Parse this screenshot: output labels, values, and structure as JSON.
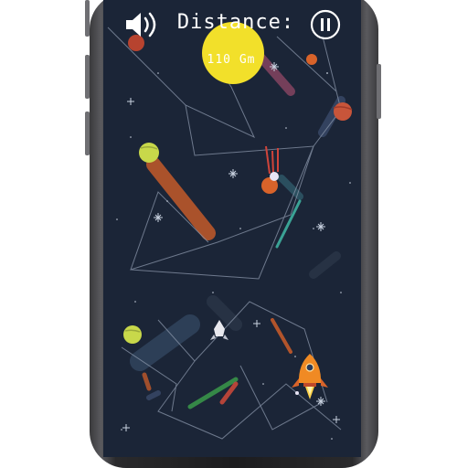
{
  "hud": {
    "distance_label": "Distance:",
    "distance_value": "110 Gm",
    "sound_icon": "speaker-icon",
    "pause_icon": "pause-icon"
  },
  "colors": {
    "space_bg": "#1b2537",
    "sun": "#f2e02a",
    "rocket": "#f08a24",
    "planet_lime": "#c8d84a",
    "planet_red": "#c8553a"
  }
}
